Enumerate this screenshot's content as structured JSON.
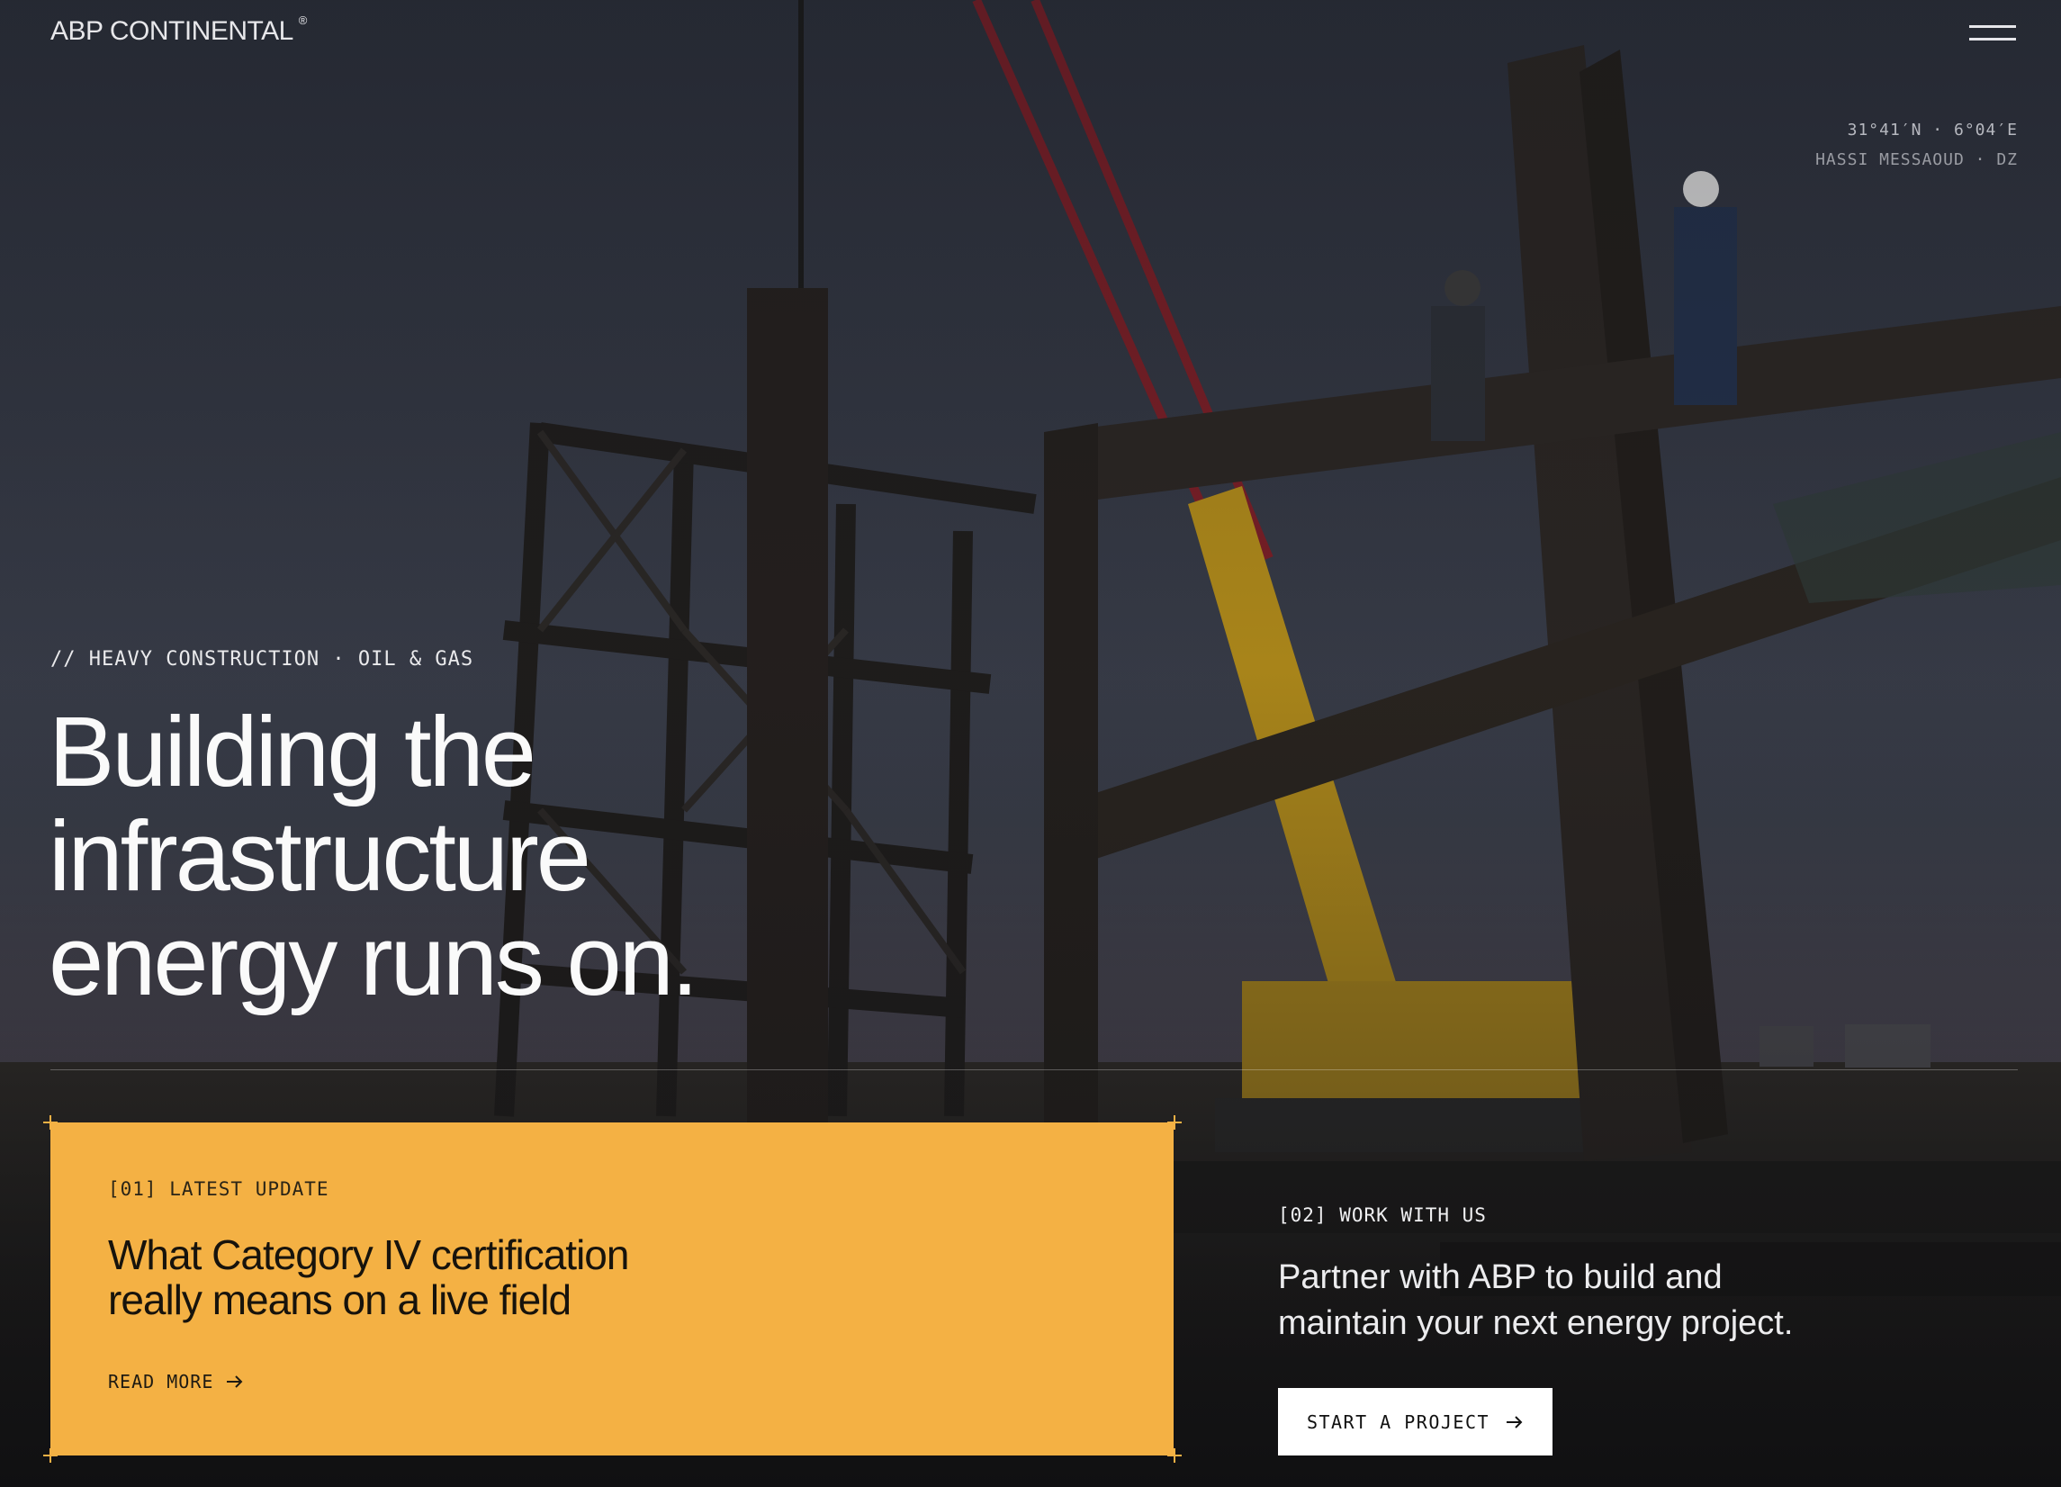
{
  "brand": {
    "name": "ABP CONTINENTAL",
    "mark": "®"
  },
  "nav": {
    "menu_icon": "hamburger-icon"
  },
  "location": {
    "coordinates": "31°41′N · 6°04′E",
    "place": "HASSI MESSAOUD · DZ"
  },
  "hero": {
    "eyebrow": "// HEAVY CONSTRUCTION · OIL & GAS",
    "headline_lines": [
      "Building the",
      "infrastructure",
      "energy runs on."
    ],
    "background": "steel-frame-construction-site-photo"
  },
  "update_card": {
    "label": "[01] LATEST UPDATE",
    "title_lines": [
      "What Category IV certification",
      "really means on a live field"
    ],
    "link_label": "READ MORE",
    "link_icon": "arrow-right-icon",
    "color": "#f4b144"
  },
  "work_with_us": {
    "label": "[02] WORK WITH US",
    "text_lines": [
      "Partner with ABP to build and",
      "maintain your next energy project."
    ],
    "cta_label": "START A PROJECT",
    "cta_icon": "arrow-right-icon"
  }
}
